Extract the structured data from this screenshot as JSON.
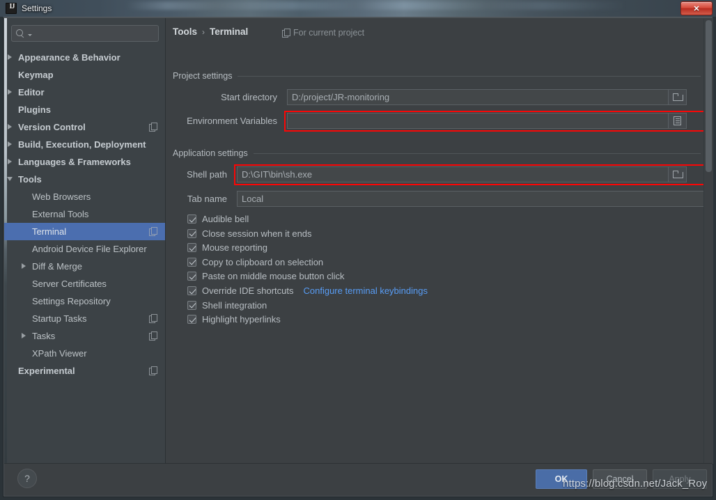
{
  "window": {
    "title": "Settings",
    "app_icon": "intellij-idea-icon",
    "close_label": "✕"
  },
  "sidebar": {
    "search": {
      "placeholder": "",
      "value": "",
      "icon": "search-icon"
    },
    "items": [
      {
        "label": "Appearance & Behavior",
        "level": 0,
        "twisty": "collapsed",
        "badge": false,
        "selected": false
      },
      {
        "label": "Keymap",
        "level": 0,
        "twisty": "none",
        "badge": false,
        "selected": false
      },
      {
        "label": "Editor",
        "level": 0,
        "twisty": "collapsed",
        "badge": false,
        "selected": false
      },
      {
        "label": "Plugins",
        "level": 0,
        "twisty": "none",
        "badge": false,
        "selected": false
      },
      {
        "label": "Version Control",
        "level": 0,
        "twisty": "collapsed",
        "badge": true,
        "selected": false
      },
      {
        "label": "Build, Execution, Deployment",
        "level": 0,
        "twisty": "collapsed",
        "badge": false,
        "selected": false
      },
      {
        "label": "Languages & Frameworks",
        "level": 0,
        "twisty": "collapsed",
        "badge": false,
        "selected": false
      },
      {
        "label": "Tools",
        "level": 0,
        "twisty": "expanded",
        "badge": false,
        "selected": false
      },
      {
        "label": "Web Browsers",
        "level": 1,
        "twisty": "none",
        "badge": false,
        "selected": false
      },
      {
        "label": "External Tools",
        "level": 1,
        "twisty": "none",
        "badge": false,
        "selected": false
      },
      {
        "label": "Terminal",
        "level": 1,
        "twisty": "none",
        "badge": true,
        "selected": true
      },
      {
        "label": "Android Device File Explorer",
        "level": 1,
        "twisty": "none",
        "badge": false,
        "selected": false
      },
      {
        "label": "Diff & Merge",
        "level": 1,
        "twisty": "collapsed",
        "badge": false,
        "selected": false
      },
      {
        "label": "Server Certificates",
        "level": 1,
        "twisty": "none",
        "badge": false,
        "selected": false
      },
      {
        "label": "Settings Repository",
        "level": 1,
        "twisty": "none",
        "badge": false,
        "selected": false
      },
      {
        "label": "Startup Tasks",
        "level": 1,
        "twisty": "none",
        "badge": true,
        "selected": false
      },
      {
        "label": "Tasks",
        "level": 1,
        "twisty": "collapsed",
        "badge": true,
        "selected": false
      },
      {
        "label": "XPath Viewer",
        "level": 1,
        "twisty": "none",
        "badge": false,
        "selected": false
      },
      {
        "label": "Experimental",
        "level": 0,
        "twisty": "none",
        "badge": true,
        "selected": false
      }
    ]
  },
  "content": {
    "breadcrumb": {
      "root": "Tools",
      "separator": "›",
      "leaf": "Terminal"
    },
    "scope_note": "For current project",
    "project_settings": {
      "group_title": "Project settings",
      "start_directory": {
        "label": "Start directory",
        "value": "D:/project/JR-monitoring",
        "button_icon": "folder-icon"
      },
      "environment_variables": {
        "label": "Environment Variables",
        "value": "",
        "button_icon": "list-icon",
        "highlighted": true
      }
    },
    "application_settings": {
      "group_title": "Application settings",
      "shell_path": {
        "label": "Shell path",
        "value": "D:\\GIT\\bin\\sh.exe",
        "button_icon": "folder-icon",
        "highlighted": true
      },
      "tab_name": {
        "label": "Tab name",
        "value": "Local"
      },
      "checkboxes": [
        {
          "label": "Audible bell",
          "checked": true
        },
        {
          "label": "Close session when it ends",
          "checked": true
        },
        {
          "label": "Mouse reporting",
          "checked": true
        },
        {
          "label": "Copy to clipboard on selection",
          "checked": true
        },
        {
          "label": "Paste on middle mouse button click",
          "checked": true
        },
        {
          "label": "Override IDE shortcuts",
          "checked": true,
          "link": "Configure terminal keybindings"
        },
        {
          "label": "Shell integration",
          "checked": true
        },
        {
          "label": "Highlight hyperlinks",
          "checked": true
        }
      ]
    }
  },
  "footer": {
    "help_label": "?",
    "ok_label": "OK",
    "cancel_label": "Cancel",
    "apply_label": "Apply"
  },
  "watermark": {
    "text": "https://blog.csdn.net/Jack_Roy"
  },
  "colors": {
    "panel_bg": "#3C4043",
    "sidebar_bg": "#3C4246",
    "selection_blue": "#4B6EAF",
    "link_blue": "#589DF6",
    "highlight_red": "#FB0606",
    "field_bg": "#45494D",
    "ok_button": "#4A6DA7"
  }
}
